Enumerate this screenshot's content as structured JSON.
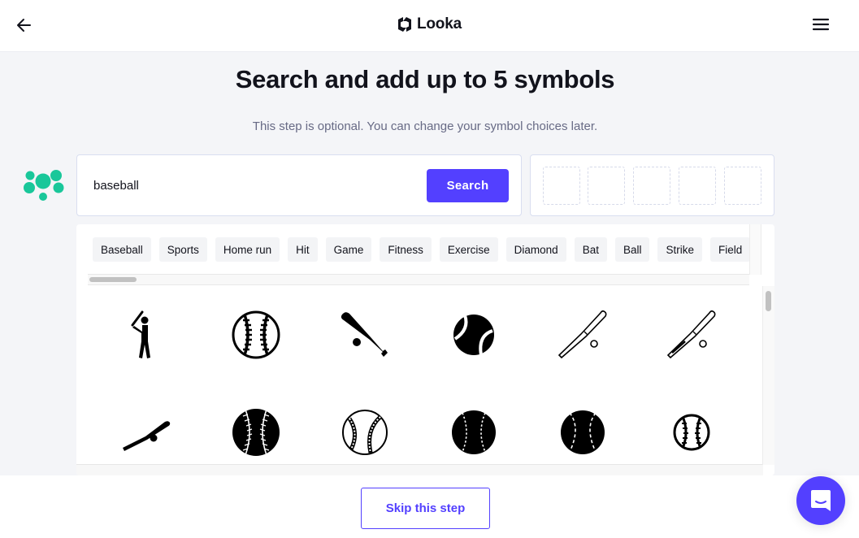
{
  "header": {
    "back_icon": "arrow-left-icon",
    "logo_text": "Looka",
    "menu_icon": "hamburger-menu-icon"
  },
  "main": {
    "title": "Search and add up to 5 symbols",
    "subtitle": "This step is optional. You can change your symbol choices later."
  },
  "search": {
    "value": "baseball",
    "placeholder": "",
    "button_label": "Search"
  },
  "selected_slots": {
    "max": 5,
    "filled": 0
  },
  "tags": [
    "Baseball",
    "Sports",
    "Home run",
    "Hit",
    "Game",
    "Fitness",
    "Exercise",
    "Diamond",
    "Bat",
    "Ball",
    "Strike",
    "Field"
  ],
  "symbols": [
    {
      "name": "batter-icon"
    },
    {
      "name": "baseball-outline-icon"
    },
    {
      "name": "bat-and-ball-icon"
    },
    {
      "name": "ball-solid-icon"
    },
    {
      "name": "thin-bat-ball-icon"
    },
    {
      "name": "thin-bat-ball-icon-2"
    },
    {
      "name": "short-bat-ball-icon"
    },
    {
      "name": "baseball-solid-stitched-icon"
    },
    {
      "name": "baseball-detailed-icon"
    },
    {
      "name": "baseball-dashed-icon"
    },
    {
      "name": "baseball-dashed-icon-2"
    },
    {
      "name": "baseball-small-outline-icon"
    }
  ],
  "footer": {
    "skip_label": "Skip this step"
  },
  "colors": {
    "accent": "#5340ff",
    "brand_green": "#19c79a"
  },
  "chat": {
    "icon": "chat-bubble-icon"
  }
}
